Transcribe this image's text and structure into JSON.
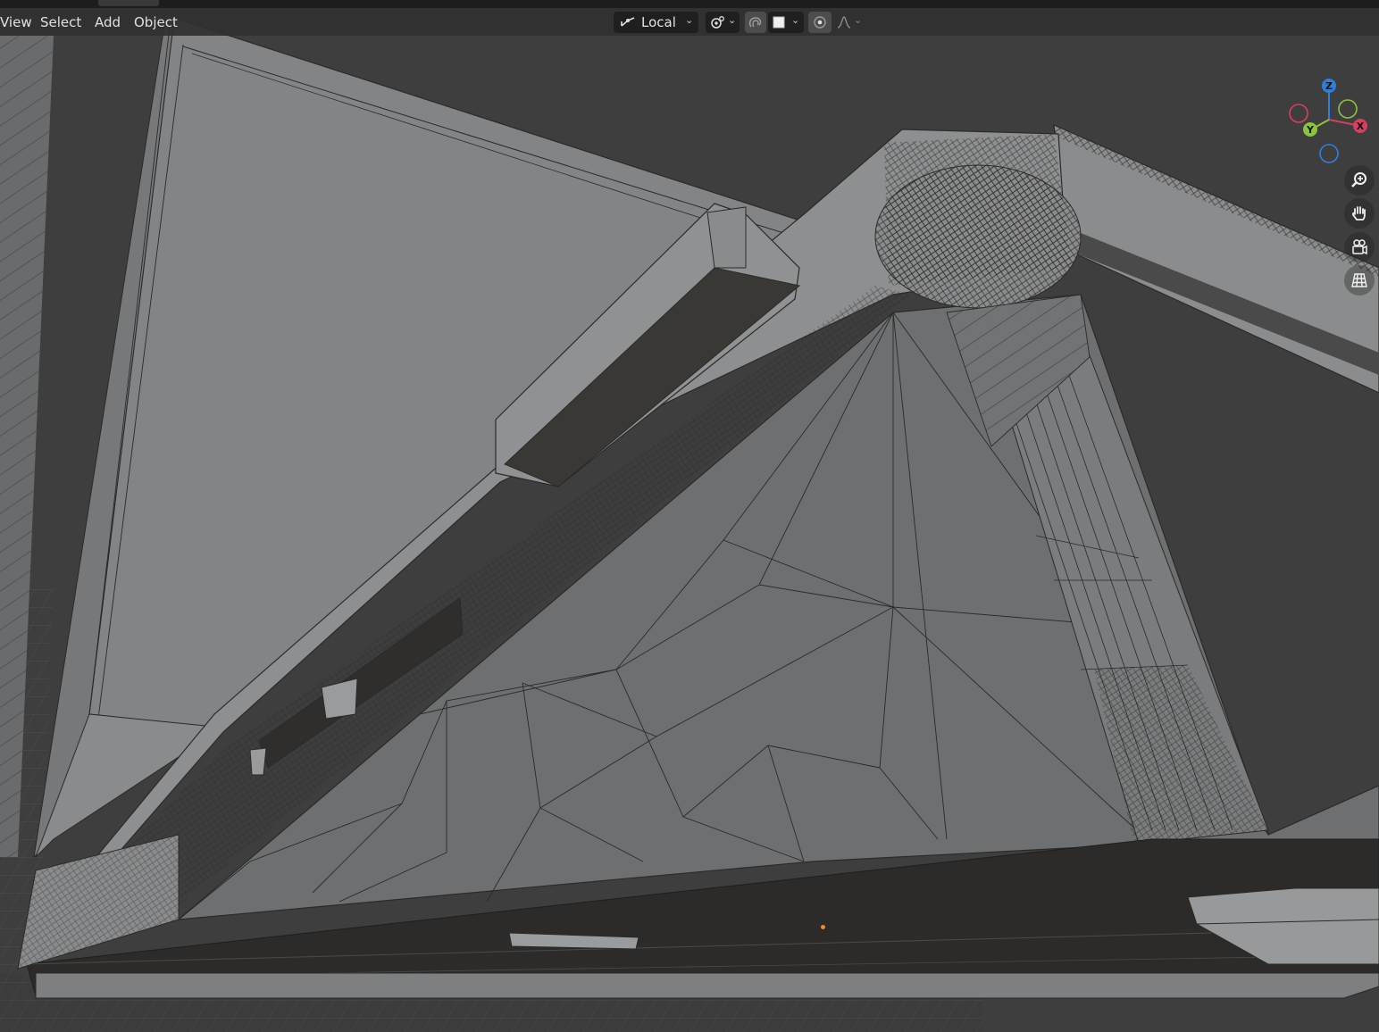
{
  "header": {
    "menus": [
      "View",
      "Select",
      "Add",
      "Object"
    ],
    "transform_orientation": "Local",
    "icons": {
      "orientation": "transform-orientation-icon",
      "pivot": "pivot-point-icon",
      "snap": "snap-magnet-icon",
      "snap_target": "snap-increment-icon",
      "proportional": "proportional-editing-icon",
      "falloff": "falloff-curve-icon"
    }
  },
  "gizmo": {
    "axes": {
      "z": "Z",
      "x": "X",
      "y": "Y"
    },
    "colors": {
      "x": "#d4405e",
      "y": "#8bc53f",
      "z": "#2f7fd6"
    }
  },
  "navigation": [
    "zoom-icon",
    "pan-hand-icon",
    "camera-view-icon",
    "perspective-toggle-icon"
  ],
  "viewport": {
    "background": "#3d3d3d",
    "mesh_face_color": "#7a7b7c",
    "mesh_wire_color": "#2a2a2a",
    "origin_color": "#f08a24"
  }
}
